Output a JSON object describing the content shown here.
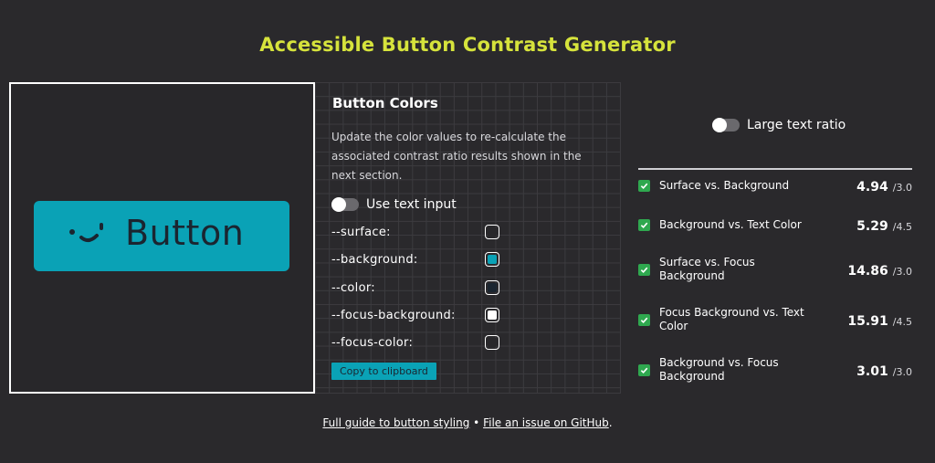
{
  "page": {
    "title": "Accessible Button Contrast Generator"
  },
  "preview": {
    "button_label": "Button",
    "button_color": "#0aa2b6",
    "text_color": "#1b2530"
  },
  "colors": {
    "title": "Button Colors",
    "description": "Update the color values to re-calculate the associated contrast ratio results shown in the next section.",
    "text_input_toggle": "Use text input",
    "text_input_on": false,
    "fields": [
      {
        "label": "--surface:",
        "color": "#28272a"
      },
      {
        "label": "--background:",
        "color": "#0aa2b6"
      },
      {
        "label": "--color:",
        "color": "#1b2530"
      },
      {
        "label": "--focus-background:",
        "color": "#ffffff"
      },
      {
        "label": "--focus-color:",
        "color": "#28272a"
      }
    ],
    "copy_button": "Copy to clipboard"
  },
  "results": {
    "large_text_toggle": "Large text ratio",
    "large_text_on": false,
    "items": [
      {
        "label": "Surface vs. Background",
        "ratio": "4.94",
        "target": "/3.0",
        "pass_icon": "check-icon"
      },
      {
        "label": "Background vs. Text Color",
        "ratio": "5.29",
        "target": "/4.5",
        "pass_icon": "check-icon"
      },
      {
        "label": "Surface vs. Focus Background",
        "ratio": "14.86",
        "target": "/3.0",
        "pass_icon": "check-icon"
      },
      {
        "label": "Focus Background vs. Text Color",
        "ratio": "15.91",
        "target": "/4.5",
        "pass_icon": "check-icon"
      },
      {
        "label": "Background vs. Focus Background",
        "ratio": "3.01",
        "target": "/3.0",
        "pass_icon": "check-icon"
      }
    ]
  },
  "footer": {
    "guide_link": "Full guide to button styling",
    "separator": "•",
    "issue_link": "File an issue on GitHub",
    "period": "."
  },
  "theme": {
    "page_background": "#2a292c",
    "title_color": "#d6e33c",
    "accent": "#0aa2b6",
    "pass_color": "#2fa84f"
  }
}
